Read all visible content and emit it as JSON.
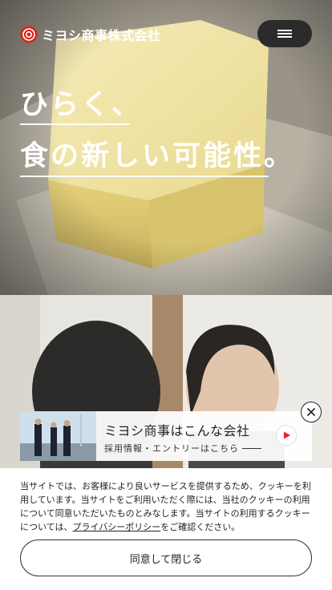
{
  "brand": {
    "name": "ミヨシ商事株式会社",
    "logo_color": "#d7261b",
    "icon": "company-logo-mark"
  },
  "header": {
    "menu_icon": "hamburger-icon",
    "menu_button_color": "#2b2b2b"
  },
  "hero": {
    "line1": "ひらく、",
    "line2": "食の新しい可能性。"
  },
  "promo": {
    "title": "ミヨシ商事はこんな会社",
    "subtitle": "採用情報・エントリーはこちら",
    "play_icon": "play-icon",
    "accent": "#e8202a"
  },
  "close_icon": "close-icon",
  "cookie": {
    "text_before": "当サイトでは、お客様により良いサービスを提供するため、クッキーを利用しています。当サイトをご利用いただく際には、当社のクッキーの利用について同意いただいたものとみなします。当サイトの利用するクッキーについては、",
    "link_label": "プライバシーポリシー",
    "text_after": "をご確認ください。",
    "agree_label": "同意して閉じる"
  }
}
